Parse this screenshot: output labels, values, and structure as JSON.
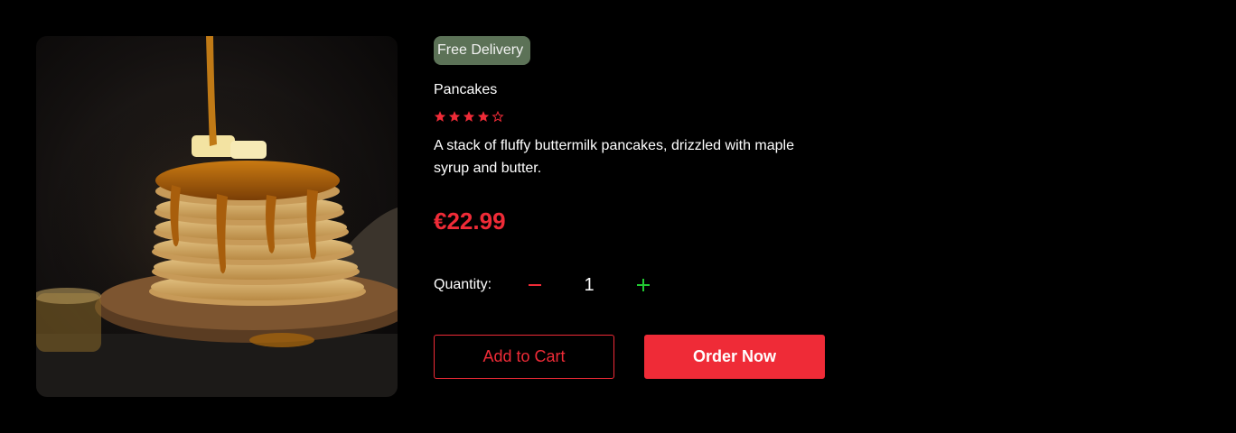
{
  "product": {
    "badge": "Free Delivery",
    "title": "Pancakes",
    "rating": {
      "value": 4,
      "max": 5
    },
    "description": "A stack of fluffy buttermilk pancakes, drizzled with maple syrup and butter.",
    "price": "€22.99",
    "image_icon": "pancake-photo"
  },
  "quantity": {
    "label": "Quantity:",
    "value": "1",
    "decrement_icon": "minus-icon",
    "increment_icon": "plus-icon"
  },
  "actions": {
    "add_to_cart_label": "Add to Cart",
    "order_now_label": "Order Now"
  },
  "colors": {
    "accent": "#ef2b37",
    "badge_bg": "#5c7257",
    "increment": "#22c933",
    "background": "#000000"
  }
}
